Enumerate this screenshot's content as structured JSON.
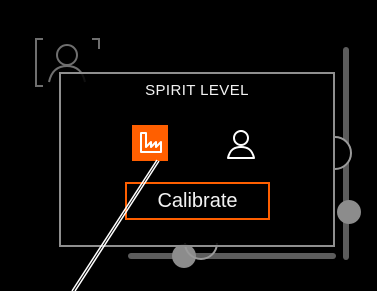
{
  "panel": {
    "title": "SPIRIT LEVEL",
    "button_label": "Calibrate"
  },
  "icons": {
    "background_icon": "user-frame-icon",
    "factory_icon": "factory-icon",
    "user_icon": "user-icon"
  },
  "colors": {
    "accent": "#ff5f00",
    "panel_border": "#8f8f8f",
    "text": "#f2f2f2",
    "background": "#000000"
  }
}
